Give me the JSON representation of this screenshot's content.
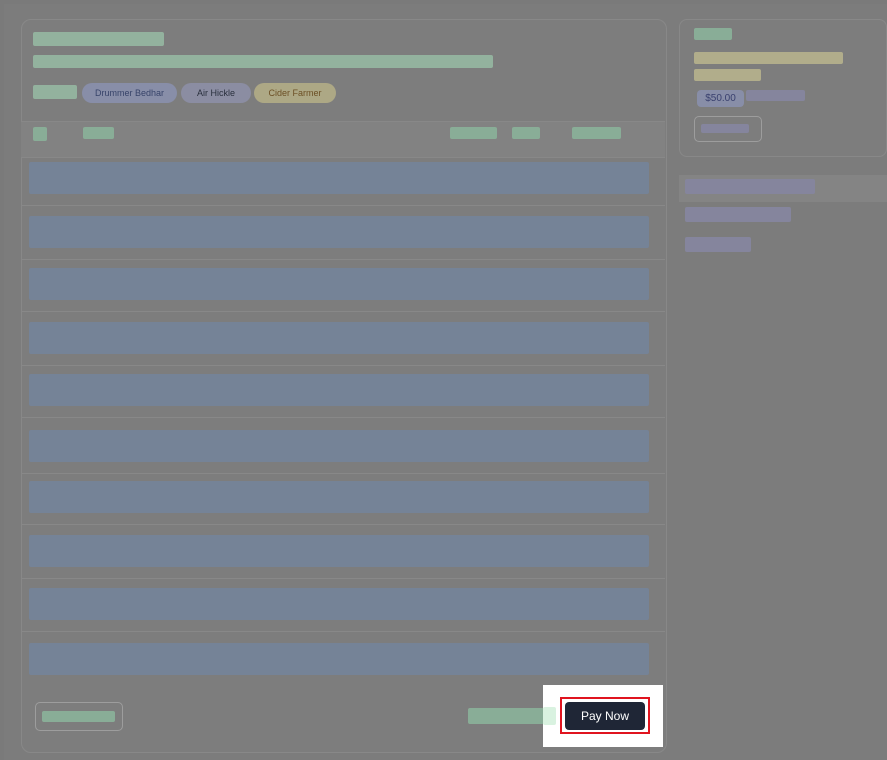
{
  "tags": [
    {
      "label": "Drummer Bedhar",
      "bg": "#8a90ad",
      "color": "#2f3d67"
    },
    {
      "label": "Air Hickle",
      "bg": "#8d8fa6",
      "color": "#202736"
    },
    {
      "label": "Cider Farmer",
      "bg": "#b3ad86",
      "color": "#6a4b1b"
    }
  ],
  "summary": {
    "price": "$50.00"
  },
  "actions": {
    "pay_now": "Pay Now"
  },
  "colors": {
    "primary_button": "#1f2636",
    "highlight_border": "#e0141f"
  }
}
